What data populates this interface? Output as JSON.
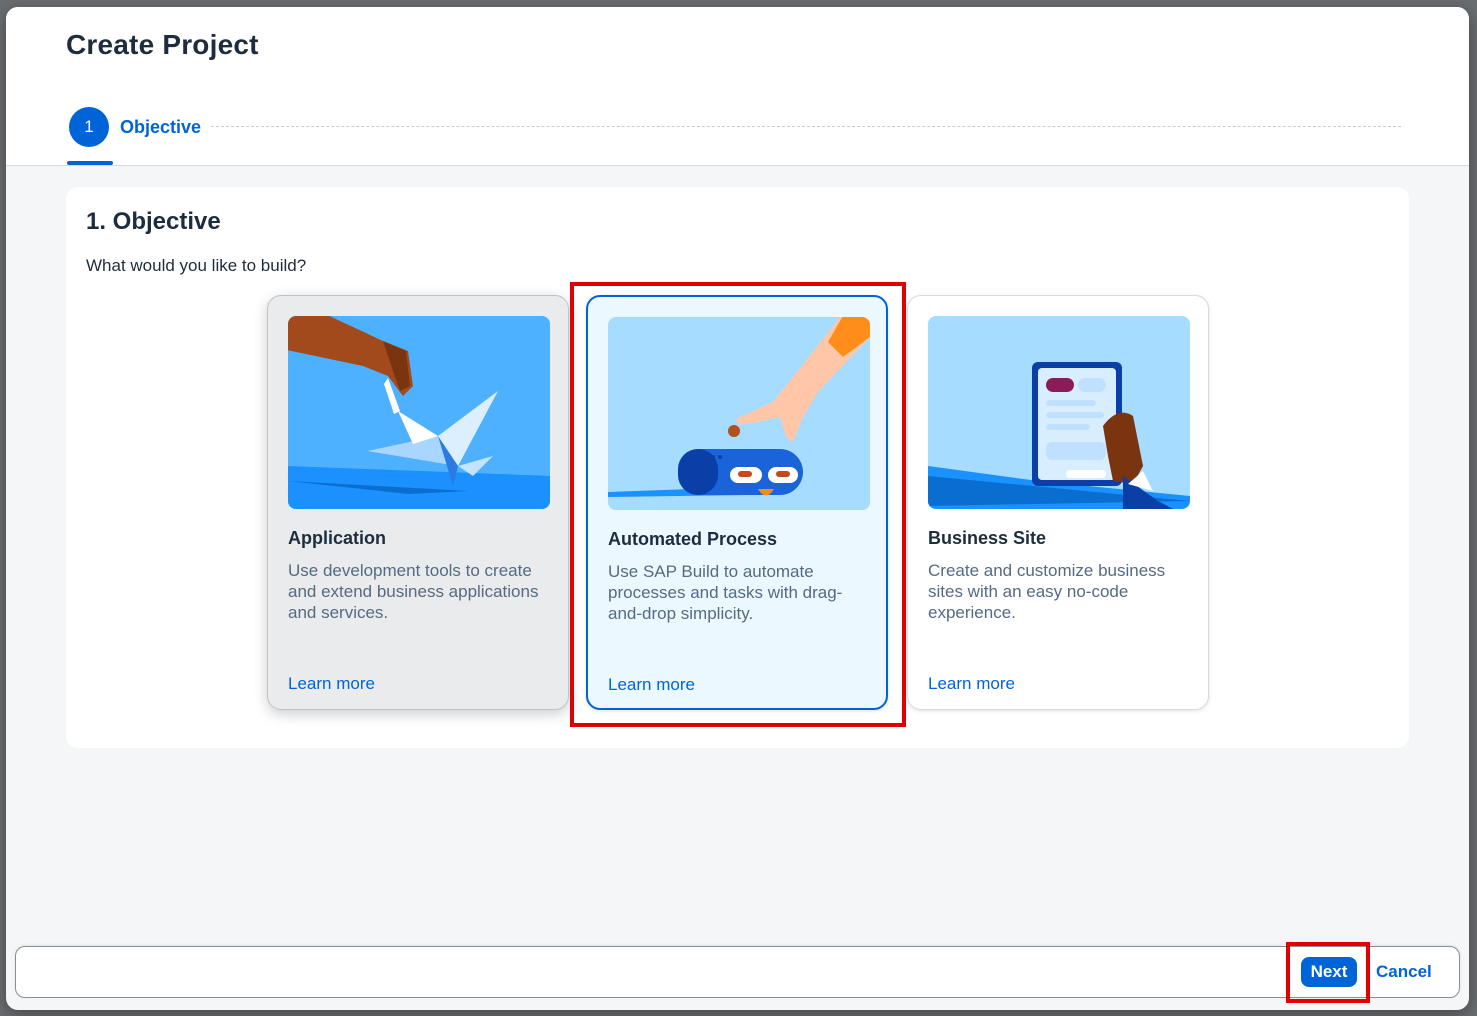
{
  "dialog": {
    "title": "Create Project"
  },
  "wizard": {
    "steps": [
      {
        "number": "1",
        "label": "Objective"
      }
    ]
  },
  "section": {
    "title": "1. Objective",
    "question": "What would you like to build?"
  },
  "cards": [
    {
      "title": "Application",
      "description": "Use development tools to create and extend business applications and services.",
      "link": "Learn more",
      "illustration": "hand-folding-paper-crane"
    },
    {
      "title": "Automated Process",
      "description": "Use SAP Build to automate processes and tasks with drag-and-drop simplicity.",
      "link": "Learn more",
      "illustration": "hand-feeding-robot"
    },
    {
      "title": "Business Site",
      "description": "Create and customize business sites with an easy no-code experience.",
      "link": "Learn more",
      "illustration": "hand-holding-tablet"
    }
  ],
  "footer": {
    "next_label": "Next",
    "cancel_label": "Cancel"
  },
  "colors": {
    "accent": "#0064d9",
    "highlight": "#e00000",
    "selected_card_bg": "#ebf8ff"
  }
}
